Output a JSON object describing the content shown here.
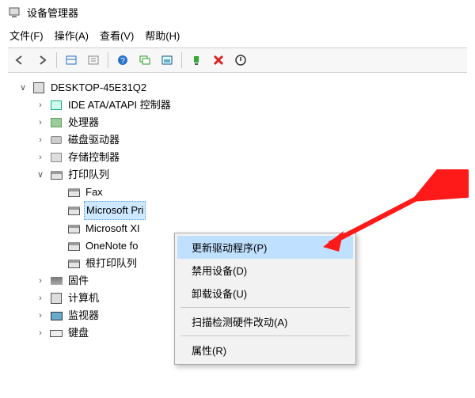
{
  "window": {
    "title": "设备管理器"
  },
  "menu": {
    "file": "文件(F)",
    "action": "操作(A)",
    "view": "查看(V)",
    "help": "帮助(H)"
  },
  "tree": {
    "root": "DESKTOP-45E31Q2",
    "items": [
      {
        "label": "IDE ATA/ATAPI 控制器"
      },
      {
        "label": "处理器"
      },
      {
        "label": "磁盘驱动器"
      },
      {
        "label": "存储控制器"
      },
      {
        "label": "打印队列"
      },
      {
        "label": "固件"
      },
      {
        "label": "计算机"
      },
      {
        "label": "监视器"
      },
      {
        "label": "键盘"
      }
    ],
    "printers": [
      {
        "label": "Fax"
      },
      {
        "label": "Microsoft Pri"
      },
      {
        "label": "Microsoft XI"
      },
      {
        "label": "OneNote fo"
      },
      {
        "label": "根打印队列"
      }
    ]
  },
  "context_menu": {
    "update": "更新驱动程序(P)",
    "disable": "禁用设备(D)",
    "uninstall": "卸载设备(U)",
    "scan": "扫描检测硬件改动(A)",
    "properties": "属性(R)"
  }
}
